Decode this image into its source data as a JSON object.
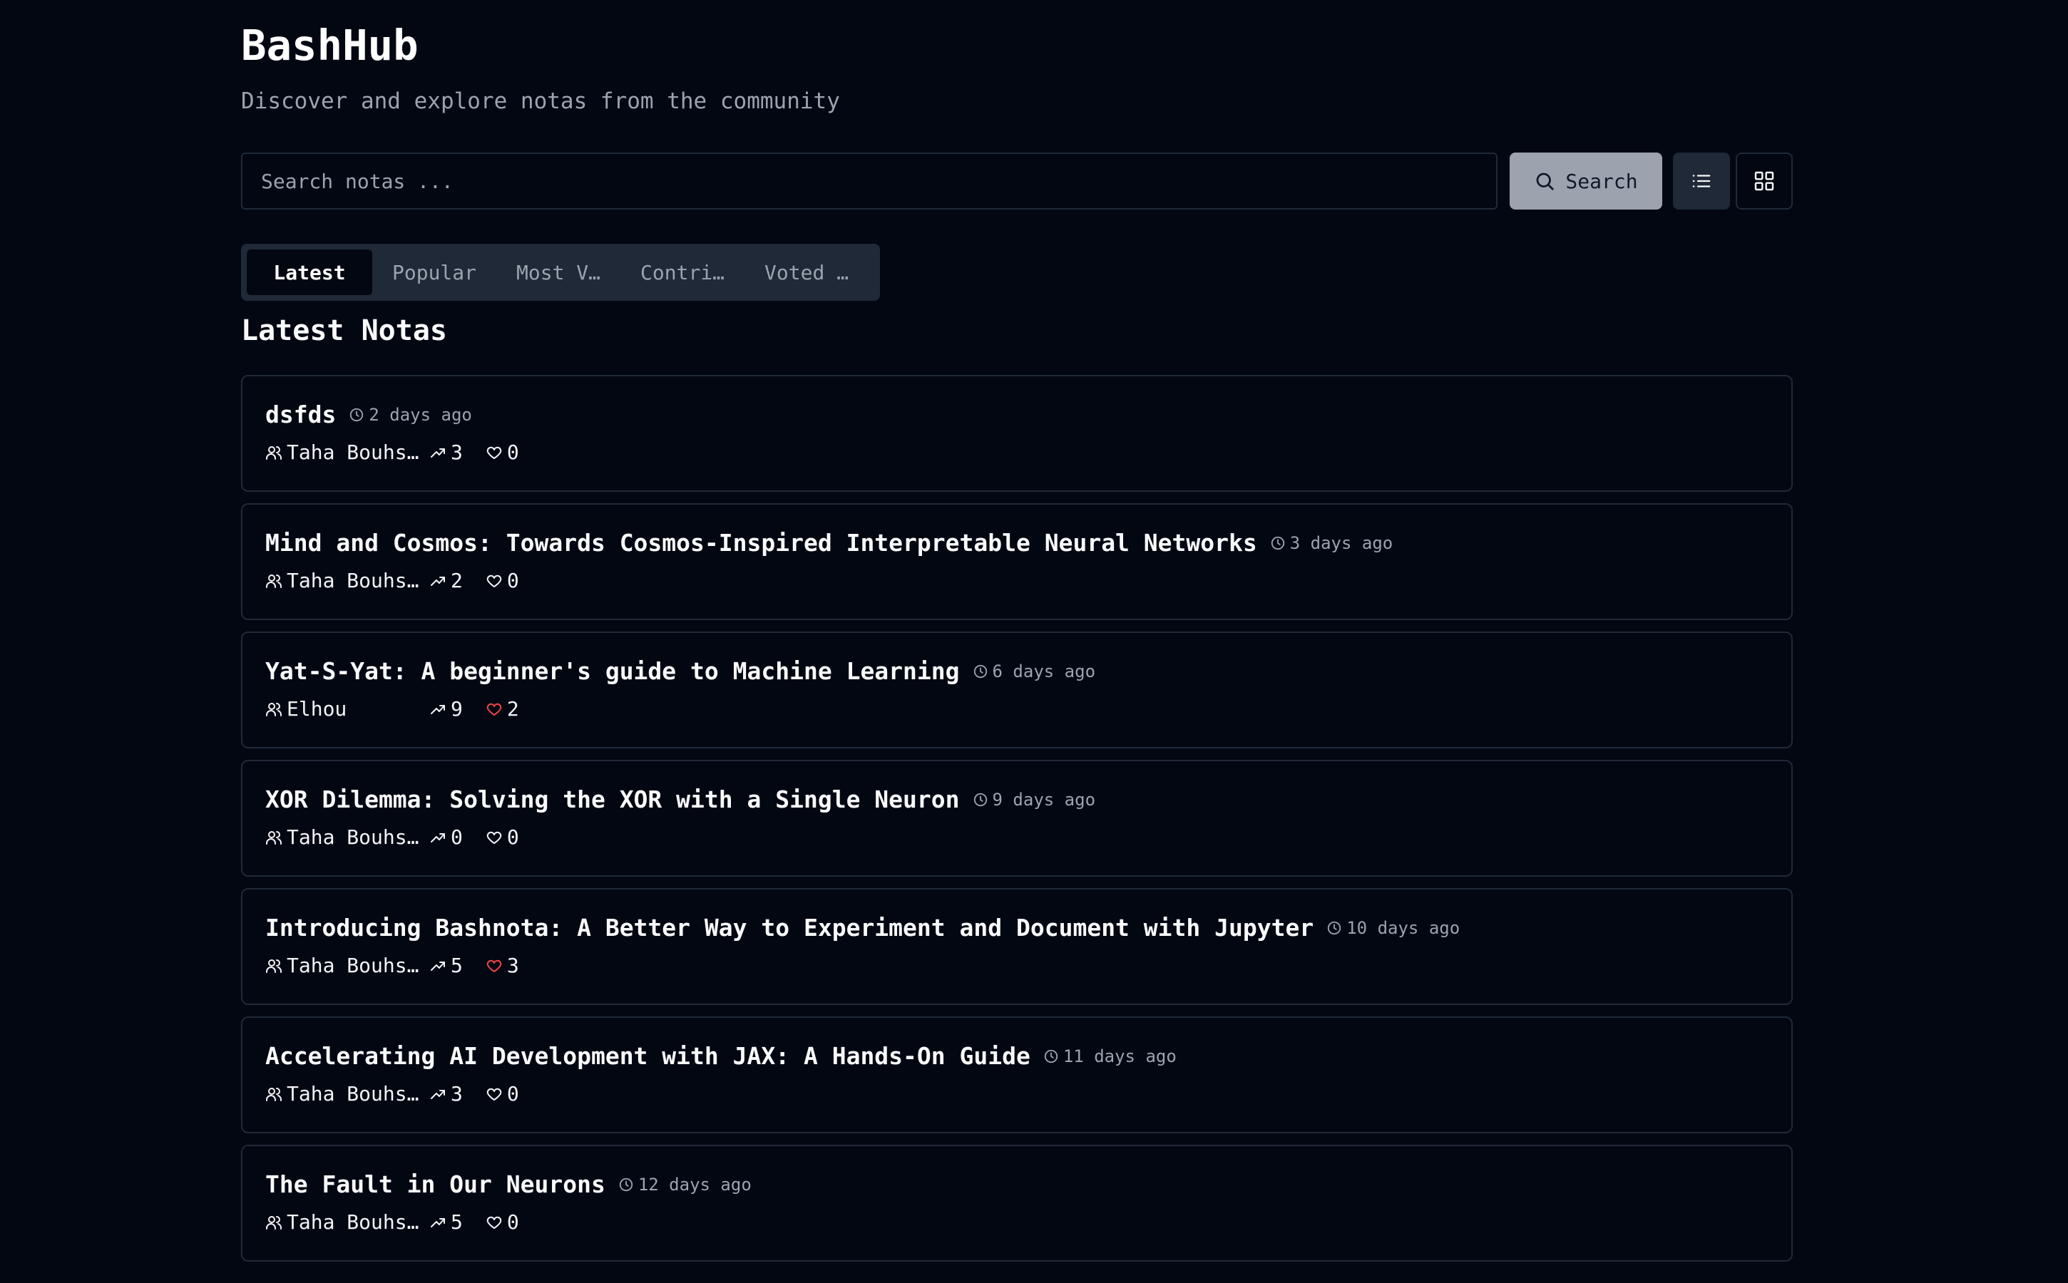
{
  "app": {
    "title": "BashHub",
    "subtitle": "Discover and explore notas from the community"
  },
  "search": {
    "placeholder": "Search notas ...",
    "button_label": "Search"
  },
  "view_toggle": {
    "list_icon": "list-icon",
    "grid_icon": "grid-icon"
  },
  "tabs": [
    {
      "label": "Latest",
      "active": true
    },
    {
      "label": "Popular"
    },
    {
      "label": "Most V…"
    },
    {
      "label": "Contri…"
    },
    {
      "label": "Voted …"
    }
  ],
  "section": {
    "title": "Latest Notas"
  },
  "colors": {
    "background": "#030712",
    "border": "#1f2937",
    "muted": "#9ca3af",
    "liked": "#ef4444"
  },
  "notas": [
    {
      "title": "dsfds",
      "time": "2 days ago",
      "author": "Taha Bouhs…",
      "views": "3",
      "likes": "0",
      "liked": false
    },
    {
      "title": "Mind and Cosmos: Towards Cosmos-Inspired Interpretable Neural Networks",
      "time": "3 days ago",
      "author": "Taha Bouhs…",
      "views": "2",
      "likes": "0",
      "liked": false
    },
    {
      "title": "Yat-S-Yat: A beginner's guide to Machine Learning",
      "time": "6 days ago",
      "author": "Elhou",
      "views": "9",
      "likes": "2",
      "liked": true
    },
    {
      "title": "XOR Dilemma: Solving the XOR with a Single Neuron",
      "time": "9 days ago",
      "author": "Taha Bouhs…",
      "views": "0",
      "likes": "0",
      "liked": false
    },
    {
      "title": "Introducing Bashnota: A Better Way to Experiment and Document with Jupyter",
      "time": "10 days ago",
      "author": "Taha Bouhs…",
      "views": "5",
      "likes": "3",
      "liked": true
    },
    {
      "title": "Accelerating AI Development with JAX: A Hands-On Guide",
      "time": "11 days ago",
      "author": "Taha Bouhs…",
      "views": "3",
      "likes": "0",
      "liked": false
    },
    {
      "title": "The Fault in Our Neurons",
      "time": "12 days ago",
      "author": "Taha Bouhs…",
      "views": "5",
      "likes": "0",
      "liked": false
    }
  ]
}
